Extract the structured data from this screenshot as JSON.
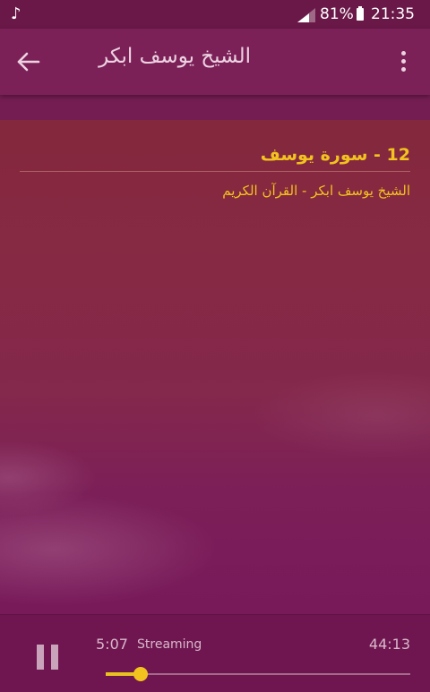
{
  "status_bar": {
    "music_icon": "music-note-icon",
    "signal_icon": "signal-icon",
    "battery_percent": "81%",
    "battery_icon": "battery-icon",
    "time": "21:35"
  },
  "toolbar": {
    "back_icon": "arrow-back-icon",
    "title": "الشيخ يوسف ابكر",
    "more_icon": "more-vert-icon"
  },
  "track": {
    "title": "12 - سورة يوسف",
    "subtitle": "الشيخ يوسف ابكر - القرآن الكريم"
  },
  "player": {
    "pause_icon": "pause-icon",
    "current_time": "5:07",
    "status": "Streaming",
    "total_time": "44:13",
    "progress_fraction": 0.116
  },
  "colors": {
    "accent": "#f2c31f",
    "toolbar": "#7c2158",
    "status_bar": "#6a1848",
    "player_bar": "#6f1650"
  }
}
